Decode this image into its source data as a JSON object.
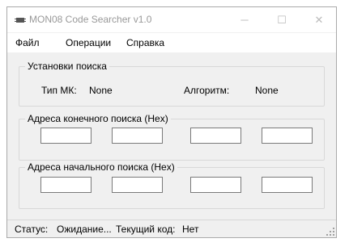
{
  "window": {
    "title": "MON08 Code Searcher v1.0",
    "controls": {
      "minimize": "─",
      "maximize": "☐",
      "close": "✕"
    }
  },
  "menu": [
    "Файл",
    "Операции",
    "Справка"
  ],
  "search_settings": {
    "title": "Установки поиска",
    "mk_label": "Тип МК:",
    "mk_value": "None",
    "algo_label": "Алгоритм:",
    "algo_value": "None"
  },
  "end_address_group": {
    "title": "Адреса конечного поиска (Hex)",
    "fields": [
      "",
      "",
      "",
      ""
    ]
  },
  "start_address_group": {
    "title": "Адреса начального поиска (Hex)",
    "fields": [
      "",
      "",
      "",
      ""
    ]
  },
  "status": {
    "label": "Статус:",
    "value": "Ожидание...",
    "code_label": "Текущий код:",
    "code_value": "Нет"
  },
  "colors": {
    "window_bg": "#f0f0f0",
    "title_text": "#999999",
    "border": "#d8d8d8"
  },
  "icons": [
    "app-icon",
    "size-grip-icon"
  ]
}
